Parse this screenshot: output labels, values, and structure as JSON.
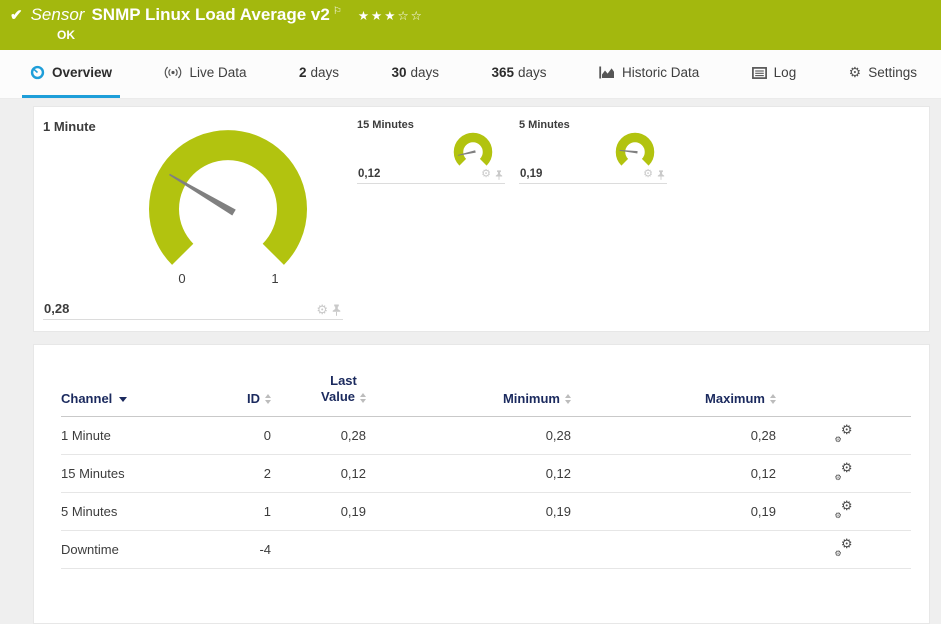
{
  "colors": {
    "status_green": "#a3b80e",
    "gauge_green": "#b2c30f",
    "accent_blue": "#1e9ed9",
    "header_navy": "#1b2a5e"
  },
  "icons": {
    "check": "✔",
    "flag": "⚐",
    "gear": "⚙",
    "stars_filled": "★★★",
    "stars_empty": "☆☆"
  },
  "header": {
    "kind_label": "Sensor",
    "title": "SNMP Linux Load Average v2",
    "status": "OK"
  },
  "tabs": {
    "overview": "Overview",
    "live_data": "Live Data",
    "d2_prefix": "2",
    "d2_label": "days",
    "d30_prefix": "30",
    "d30_label": "days",
    "d365_prefix": "365",
    "d365_label": "days",
    "historic": "Historic Data",
    "log": "Log",
    "settings": "Settings"
  },
  "gauges": [
    {
      "label": "1 Minute",
      "value": "0,28",
      "fraction": 0.28,
      "scale_min": "0",
      "scale_max": "1"
    },
    {
      "label": "15 Minutes",
      "value": "0,12",
      "fraction": 0.12
    },
    {
      "label": "5 Minutes",
      "value": "0,19",
      "fraction": 0.19
    }
  ],
  "table": {
    "col_channel": "Channel",
    "col_id": "ID",
    "col_last_1": "Last",
    "col_last_2": "Value",
    "col_min": "Minimum",
    "col_max": "Maximum",
    "rows": [
      {
        "channel": "1 Minute",
        "id": "0",
        "last": "0,28",
        "min": "0,28",
        "max": "0,28"
      },
      {
        "channel": "15 Minutes",
        "id": "2",
        "last": "0,12",
        "min": "0,12",
        "max": "0,12"
      },
      {
        "channel": "5 Minutes",
        "id": "1",
        "last": "0,19",
        "min": "0,19",
        "max": "0,19"
      },
      {
        "channel": "Downtime",
        "id": "-4",
        "last": "",
        "min": "",
        "max": ""
      }
    ]
  }
}
